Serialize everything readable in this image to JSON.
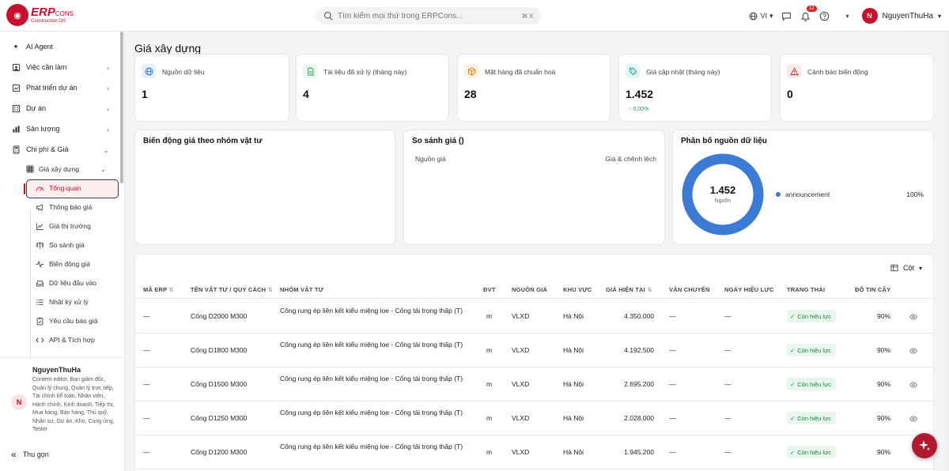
{
  "app": {
    "logo_text": "ERP",
    "logo_suffix": "CONS",
    "logo_tagline": "Construction OS",
    "search_placeholder": "Tìm kiếm mọi thứ trong ERPCons...",
    "search_shortcut": "⌘ K",
    "language": "VI",
    "notification_count": "12",
    "user_initial": "N",
    "user_name": "NguyenThuHa"
  },
  "sidebar": {
    "items": [
      {
        "label": "AI Agent",
        "icon": "sparkle-icon"
      },
      {
        "label": "Việc cần làm",
        "icon": "task-icon"
      },
      {
        "label": "Phát triển dự án",
        "icon": "trend-icon"
      },
      {
        "label": "Dự án",
        "icon": "building-icon"
      },
      {
        "label": "Sản lượng",
        "icon": "chart-icon"
      },
      {
        "label": "Chi phí & Giá",
        "icon": "calculator-icon"
      }
    ],
    "sub_group": "Giá xây dựng",
    "sub_items": [
      {
        "label": "Tổng quan",
        "icon": "gauge-icon"
      },
      {
        "label": "Thông báo giá",
        "icon": "megaphone-icon"
      },
      {
        "label": "Giá thị trường",
        "icon": "line-chart-icon"
      },
      {
        "label": "So sánh giá",
        "icon": "scale-icon"
      },
      {
        "label": "Biến động giá",
        "icon": "pulse-icon"
      },
      {
        "label": "Dữ liệu đầu vào",
        "icon": "inbox-icon"
      },
      {
        "label": "Nhật ký xử lý",
        "icon": "list-icon"
      },
      {
        "label": "Yêu cầu báo giá",
        "icon": "clipboard-icon"
      },
      {
        "label": "API & Tích hợp",
        "icon": "code-icon"
      }
    ],
    "user": {
      "initial": "N",
      "name": "NguyenThuHa",
      "roles": "Content editor, Ban giám đốc, Quản lý chung, Quản lý trực tiếp, Tài chính kế toán, Nhân viên, Hành chính, Kinh doanh, Tiếp thị, Mua hàng, Bán hàng, Thủ quỹ, Nhân sự, Dự án, Kho, Cung ứng, Tester"
    },
    "collapse_label": "Thu gọn"
  },
  "page": {
    "title": "Giá xây dựng"
  },
  "kpis": [
    {
      "label": "Nguồn dữ liệu",
      "value": "1",
      "icon": "globe-icon",
      "color": "#3b7bd5",
      "bg": "#e8f0fc"
    },
    {
      "label": "Tài liệu đã xử lý (tháng này)",
      "value": "4",
      "icon": "document-icon",
      "color": "#16a34a",
      "bg": "#e7f7ec"
    },
    {
      "label": "Mặt hàng đã chuẩn hoá",
      "value": "28",
      "icon": "box-icon",
      "color": "#d97706",
      "bg": "#fdf1e3"
    },
    {
      "label": "Giá cập nhật (tháng này)",
      "value": "1.452",
      "delta": "↑ 0,00%",
      "icon": "tag-icon",
      "color": "#0d9488",
      "bg": "#e3f6f4"
    },
    {
      "label": "Cảnh báo biến động",
      "value": "0",
      "icon": "alert-icon",
      "color": "#dc2626",
      "bg": "#fdeaea"
    }
  ],
  "panels": {
    "trend_title": "Biến động giá theo nhóm vật tư",
    "compare_title": "So sánh giá ()",
    "compare_col_source": "Nguồn giá",
    "compare_col_price": "Giá & chênh lệch",
    "distribution_title": "Phân bố nguồn dữ liệu"
  },
  "chart_data": {
    "type": "pie",
    "center_value": "1.452",
    "center_label": "Nguồn",
    "slices": [
      {
        "name": "announcement",
        "value": 100,
        "label": "100%",
        "color": "#3b7bd5"
      }
    ]
  },
  "table": {
    "columns_button": "Cột",
    "headers": [
      "MÃ ERP",
      "TÊN VẬT TƯ / QUY CÁCH",
      "NHÓM VẬT TƯ",
      "ĐVT",
      "NGUỒN GIÁ",
      "KHU VỰC",
      "GIÁ HIỆN TẠI",
      "VẬN CHUYỂN",
      "NGÀY HIỆU LỰC",
      "TRẠNG THÁI",
      "ĐỘ TIN CẬY"
    ],
    "rows": [
      {
        "erp": "—",
        "name": "Cống D2000 M300",
        "group": "Cống rung ép liên kết kiểu miệng loe - Cống tải trọng thấp (T)",
        "unit": "m",
        "source": "VLXD",
        "region": "Hà Nội",
        "price": "4.350.000",
        "transport": "—",
        "date": "—",
        "status": "Còn hiệu lực",
        "confidence": "90%"
      },
      {
        "erp": "—",
        "name": "Cống D1800 M300",
        "group": "Cống rung ép liên kết kiểu miệng loe - Cống tải trọng thấp (T)",
        "unit": "m",
        "source": "VLXD",
        "region": "Hà Nội",
        "price": "4.192.500",
        "transport": "—",
        "date": "—",
        "status": "Còn hiệu lực",
        "confidence": "90%"
      },
      {
        "erp": "—",
        "name": "Cống D1500 M300",
        "group": "Cống rung ép liên kết kiểu miệng loe - Cống tải trọng thấp (T)",
        "unit": "m",
        "source": "VLXD",
        "region": "Hà Nội",
        "price": "2.695.200",
        "transport": "—",
        "date": "—",
        "status": "Còn hiệu lực",
        "confidence": "90%"
      },
      {
        "erp": "—",
        "name": "Cống D1250 M300",
        "group": "Cống rung ép liên kết kiểu miệng loe - Cống tải trọng thấp (T)",
        "unit": "m",
        "source": "VLXD",
        "region": "Hà Nội",
        "price": "2.028.000",
        "transport": "—",
        "date": "—",
        "status": "Còn hiệu lực",
        "confidence": "90%"
      },
      {
        "erp": "—",
        "name": "Cống D1200 M300",
        "group": "Cống rung ép liên kết kiểu miệng loe - Cống tải trọng thấp (T)",
        "unit": "m",
        "source": "VLXD",
        "region": "Hà Nội",
        "price": "1.945.200",
        "transport": "—",
        "date": "—",
        "status": "Còn hiệu lực",
        "confidence": "90%"
      }
    ]
  }
}
